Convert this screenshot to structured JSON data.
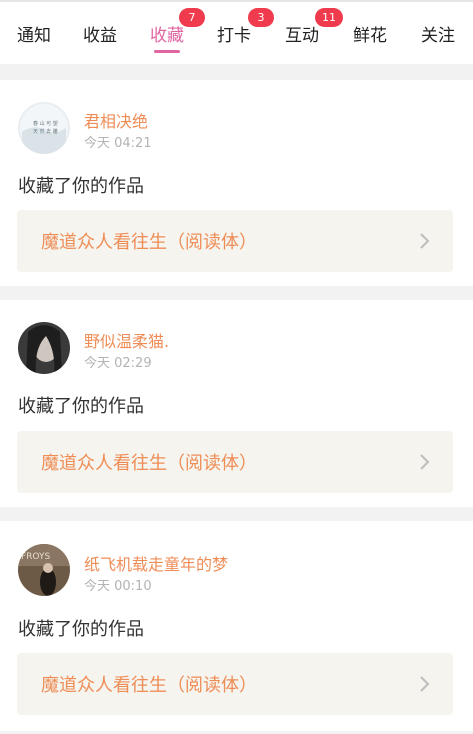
{
  "tabs": [
    {
      "label": "通知"
    },
    {
      "label": "收益"
    },
    {
      "label": "收藏",
      "badge": "7",
      "active": true
    },
    {
      "label": "打卡",
      "badge": "3"
    },
    {
      "label": "互动",
      "badge": "11"
    },
    {
      "label": "鲜花"
    },
    {
      "label": "关注"
    }
  ],
  "notifications": [
    {
      "username": "君相决绝",
      "time": "今天 04:21",
      "action": "收藏了你的作品",
      "work_title": "魔道众人看往生（阅读体）"
    },
    {
      "username": "野似温柔猫.",
      "time": "今天 02:29",
      "action": "收藏了你的作品",
      "work_title": "魔道众人看往生（阅读体）"
    },
    {
      "username": "纸飞机载走童年的梦",
      "time": "今天 00:10",
      "action": "收藏了你的作品",
      "work_title": "魔道众人看往生（阅读体）"
    }
  ],
  "colors": {
    "accent": "#e066a2",
    "badge": "#ef3b4d",
    "name": "#ef8d57"
  }
}
